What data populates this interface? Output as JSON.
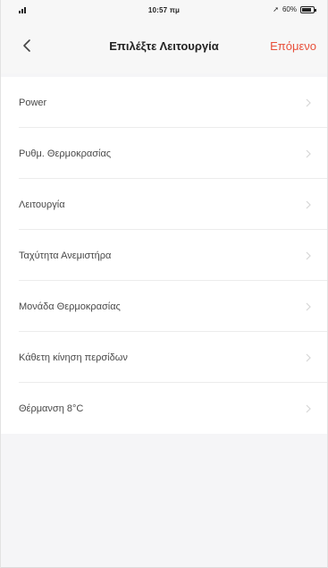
{
  "status_bar": {
    "time": "10:57 πμ",
    "battery_text": "60%",
    "signal_icon": "signal-icon",
    "battery_icon": "battery-icon"
  },
  "nav": {
    "back_icon": "chevron-left-icon",
    "title": "Επιλέξτε Λειτουργία",
    "next_label": "Επόμενο",
    "accent_color": "#e8503a"
  },
  "list": {
    "items": [
      {
        "label": "Power"
      },
      {
        "label": "Ρυθμ. Θερμοκρασίας"
      },
      {
        "label": "Λειτουργία"
      },
      {
        "label": "Ταχύτητα Ανεμιστήρα"
      },
      {
        "label": "Μονάδα Θερμοκρασίας"
      },
      {
        "label": "Κάθετη κίνηση περσίδων"
      },
      {
        "label": "Θέρμανση 8°C"
      }
    ]
  }
}
